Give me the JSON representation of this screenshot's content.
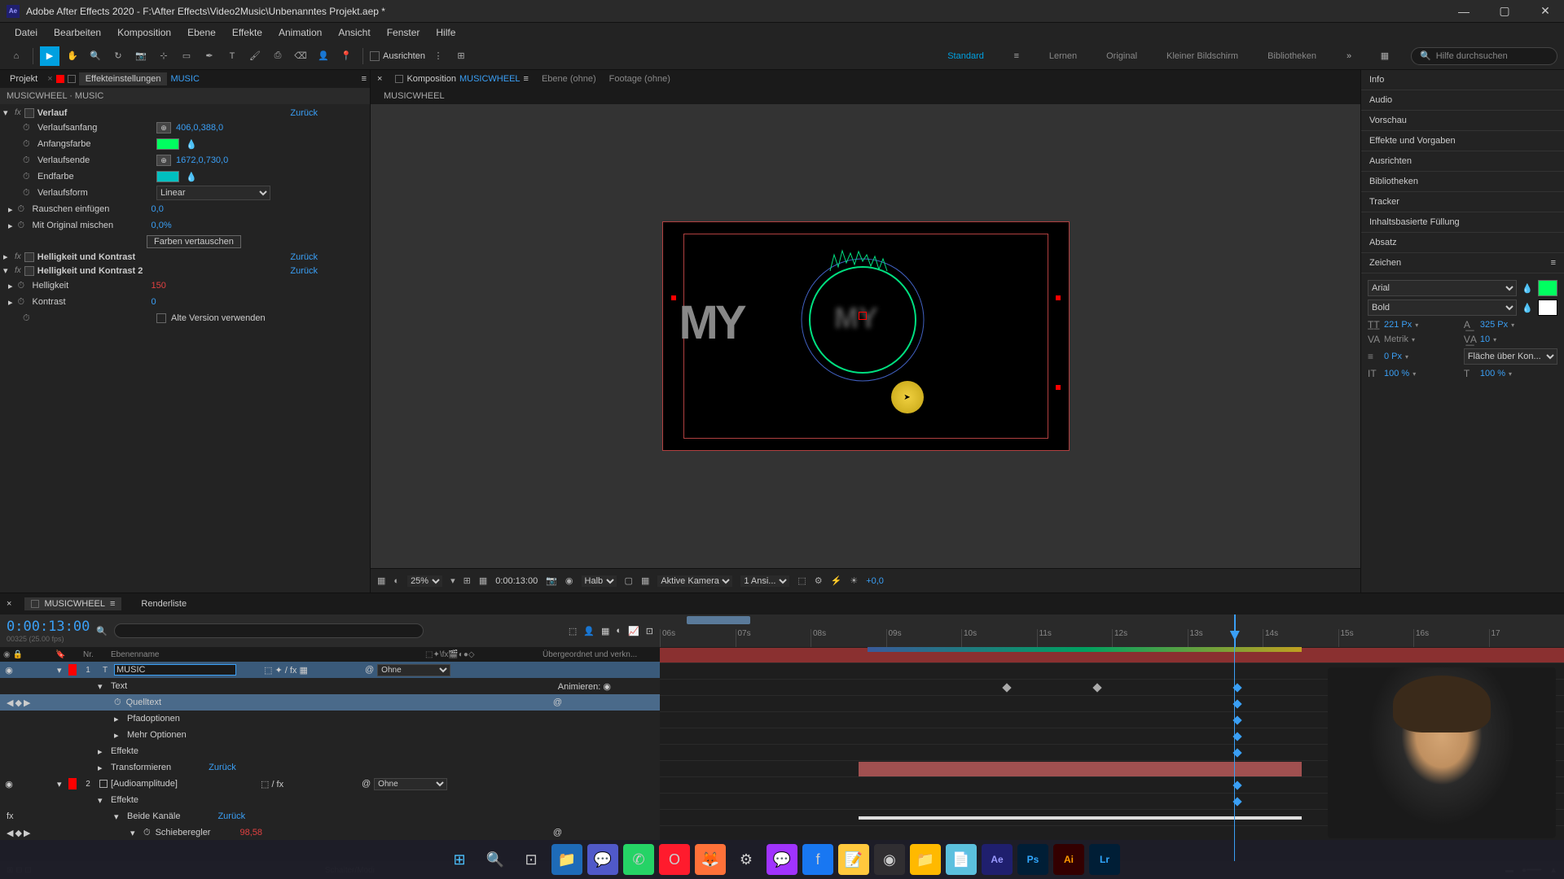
{
  "titlebar": {
    "app": "Adobe After Effects 2020",
    "path": "F:\\After Effects\\Video2Music\\Unbenanntes Projekt.aep *"
  },
  "menu": [
    "Datei",
    "Bearbeiten",
    "Komposition",
    "Ebene",
    "Effekte",
    "Animation",
    "Ansicht",
    "Fenster",
    "Hilfe"
  ],
  "toolbar": {
    "snap_label": "Ausrichten",
    "workspaces": [
      "Standard",
      "Lernen",
      "Original",
      "Kleiner Bildschirm",
      "Bibliotheken"
    ],
    "active_workspace": "Standard",
    "search_placeholder": "Hilfe durchsuchen"
  },
  "left_panel": {
    "tabs": {
      "project": "Projekt",
      "effects": "Effekteinstellungen",
      "layer": "MUSIC"
    },
    "layer_path": "MUSICWHEEL · MUSIC",
    "reset_label": "Zurück",
    "effects": [
      {
        "name": "Verlauf",
        "props": [
          {
            "name": "Verlaufsanfang",
            "type": "point",
            "value": "406,0,388,0"
          },
          {
            "name": "Anfangsfarbe",
            "type": "color",
            "value": "#00ff60"
          },
          {
            "name": "Verlaufsende",
            "type": "point",
            "value": "1672,0,730,0"
          },
          {
            "name": "Endfarbe",
            "type": "color",
            "value": "#00c0c0"
          },
          {
            "name": "Verlaufsform",
            "type": "select",
            "value": "Linear"
          },
          {
            "name": "Rauschen einfügen",
            "type": "num",
            "value": "0,0"
          },
          {
            "name": "Mit Original mischen",
            "type": "num",
            "value": "0,0%"
          }
        ],
        "swap_btn": "Farben vertauschen"
      },
      {
        "name": "Helligkeit und Kontrast",
        "props": []
      },
      {
        "name": "Helligkeit und Kontrast 2",
        "props": [
          {
            "name": "Helligkeit",
            "type": "num_red",
            "value": "150"
          },
          {
            "name": "Kontrast",
            "type": "num",
            "value": "0"
          }
        ],
        "checkbox_label": "Alte Version verwenden"
      }
    ]
  },
  "comp": {
    "tabs": {
      "composition": "Komposition",
      "name": "MUSICWHEEL",
      "layer": "Ebene (ohne)",
      "footage": "Footage (ohne)"
    },
    "breadcrumb": "MUSICWHEEL",
    "preview_text": "MY",
    "footer": {
      "zoom": "25%",
      "timecode": "0:00:13:00",
      "resolution": "Halb",
      "camera": "Aktive Kamera",
      "views": "1 Ansi...",
      "exposure": "+0,0"
    }
  },
  "right_panel": {
    "sections": [
      "Info",
      "Audio",
      "Vorschau",
      "Effekte und Vorgaben",
      "Ausrichten",
      "Bibliotheken",
      "Tracker",
      "Inhaltsbasierte Füllung",
      "Absatz"
    ],
    "character": {
      "title": "Zeichen",
      "font": "Arial",
      "weight": "Bold",
      "fill_color": "#00ff60",
      "size": "221 Px",
      "leading": "325 Px",
      "kerning": "Metrik",
      "tracking": "10",
      "stroke": "0 Px",
      "stroke_option": "Fläche über Kon...",
      "scale_h": "100 %",
      "scale_v": "100 %"
    }
  },
  "timeline": {
    "tab_name": "MUSICWHEEL",
    "render_tab": "Renderliste",
    "timecode": "0:00:13:00",
    "frame_info": "00325 (25.00 fps)",
    "cols": {
      "num": "Nr.",
      "name": "Ebenenname",
      "parent": "Übergeordnet und verkn..."
    },
    "ruler_ticks": [
      "06s",
      "07s",
      "08s",
      "09s",
      "10s",
      "11s",
      "12s",
      "13s",
      "14s",
      "15s",
      "16s",
      "17"
    ],
    "layers": [
      {
        "num": "1",
        "name": "MUSIC",
        "editing": true,
        "color": "#ff0000",
        "type": "T",
        "parent": "Ohne",
        "children": [
          {
            "name": "Text",
            "animate": "Animieren:"
          },
          {
            "name": "Quelltext",
            "selected": true,
            "has_kf": true
          },
          {
            "name": "Pfadoptionen"
          },
          {
            "name": "Mehr Optionen"
          },
          {
            "name": "Effekte"
          },
          {
            "name": "Transformieren",
            "reset": "Zurück"
          }
        ]
      },
      {
        "num": "2",
        "name": "[Audioamplitude]",
        "color": "#ff0000",
        "type": "□",
        "parent": "Ohne",
        "children": [
          {
            "name": "Effekte"
          },
          {
            "name": "Beide Kanäle",
            "reset": "Zurück"
          },
          {
            "name": "Schieberegler",
            "value": "98,58",
            "has_kf": true
          }
        ]
      }
    ],
    "footer_label": "Schalter/Modi"
  },
  "taskbar_icons": [
    "windows",
    "search",
    "tasks",
    "explorer",
    "teams",
    "whatsapp",
    "opera",
    "firefox",
    "app1",
    "messenger",
    "facebook",
    "notes",
    "obs",
    "files",
    "notepad",
    "ae",
    "ps",
    "ai",
    "lr"
  ]
}
